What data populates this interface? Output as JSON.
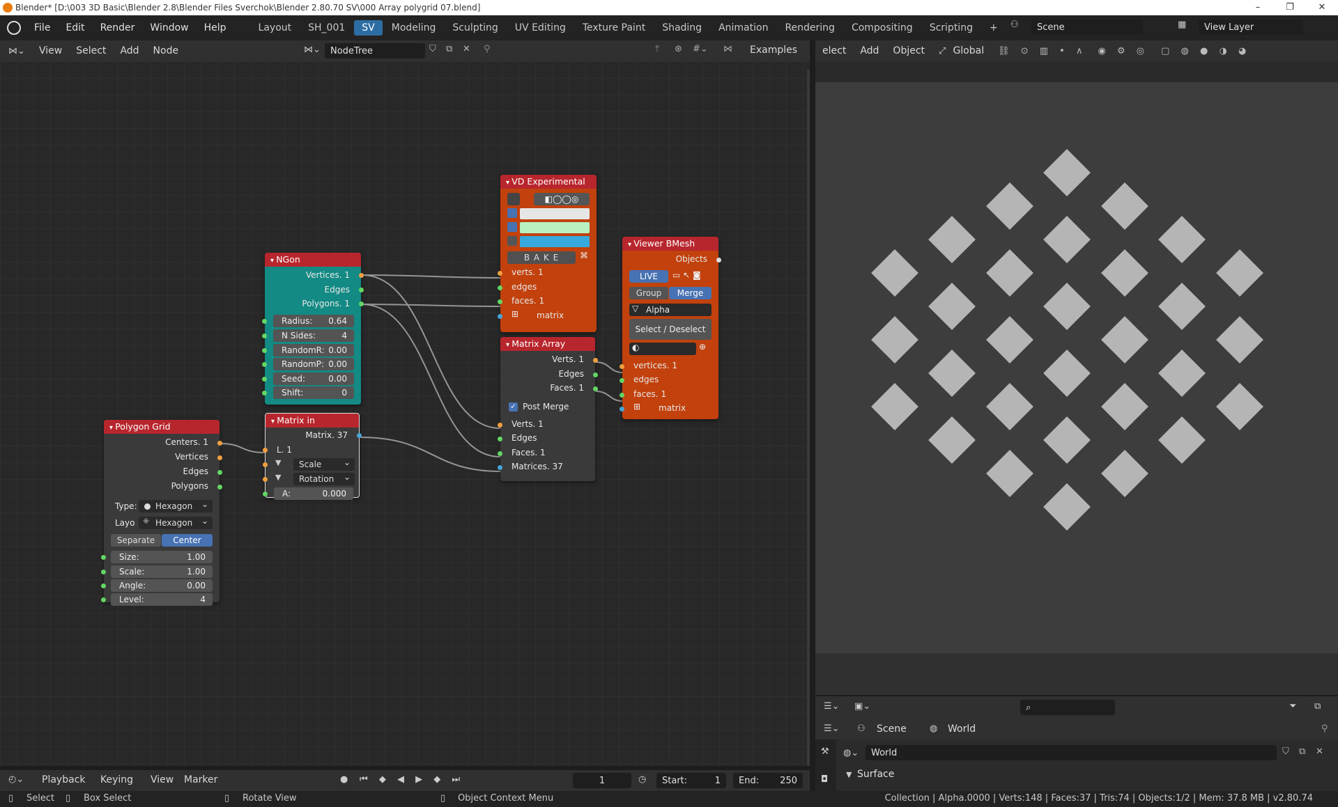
{
  "window": {
    "title": "Blender* [D:\\003 3D Basic\\Blender 2.8\\Blender Files Sverchok\\Blender 2.80.70 SV\\000 Array polygrid 07.blend]"
  },
  "topbar": {
    "menus": [
      "File",
      "Edit",
      "Render",
      "Window",
      "Help"
    ],
    "workspaces": [
      "Layout",
      "SH_001",
      "SV",
      "Modeling",
      "Sculpting",
      "UV Editing",
      "Texture Paint",
      "Shading",
      "Animation",
      "Rendering",
      "Compositing",
      "Scripting"
    ],
    "active_workspace": "SV",
    "add_tab": "+",
    "scene": "Scene",
    "view_layer": "View Layer"
  },
  "node_header": {
    "menus": [
      "View",
      "Select",
      "Add",
      "Node"
    ],
    "tree_name": "NodeTree",
    "examples": "Examples"
  },
  "viewport_header": {
    "menus": [
      "elect",
      "Add",
      "Object"
    ],
    "orientation": "Global"
  },
  "nodes": {
    "ngon": {
      "title": "NGon",
      "outputs": [
        "Vertices. 1",
        "Edges",
        "Polygons. 1"
      ],
      "fields": [
        {
          "label": "Radius:",
          "value": "0.64"
        },
        {
          "label": "N Sides:",
          "value": "4"
        },
        {
          "label": "RandomR:",
          "value": "0.00"
        },
        {
          "label": "RandomP:",
          "value": "0.00"
        },
        {
          "label": "Seed:",
          "value": "0.00"
        },
        {
          "label": "Shift:",
          "value": "0"
        }
      ]
    },
    "polygon_grid": {
      "title": "Polygon Grid",
      "outputs": [
        "Centers. 1",
        "Vertices",
        "Edges",
        "Polygons"
      ],
      "type_label": "Type:",
      "type_value": "Hexagon",
      "layout_label": "Layo",
      "layout_value": "Hexagon",
      "mode_buttons": [
        "Separate",
        "Center"
      ],
      "fields": [
        {
          "label": "Size:",
          "value": "1.00"
        },
        {
          "label": "Scale:",
          "value": "1.00"
        },
        {
          "label": "Angle:",
          "value": "0.00"
        },
        {
          "label": "Level:",
          "value": "4"
        }
      ]
    },
    "matrix_in": {
      "title": "Matrix in",
      "output": "Matrix. 37",
      "input_l": "L. 1",
      "scale": "Scale",
      "rotation": "Rotation",
      "a_label": "A:",
      "a_value": "0.000"
    },
    "vd_experimental": {
      "title": "VD Experimental",
      "bake": "B A K E",
      "inputs": [
        "verts. 1",
        "edges",
        "faces. 1",
        "matrix"
      ]
    },
    "matrix_array": {
      "title": "Matrix Array",
      "outputs": [
        "Verts. 1",
        "Edges",
        "Faces. 1"
      ],
      "post_merge": "Post Merge",
      "inputs": [
        "Verts. 1",
        "Edges",
        "Faces. 1",
        "Matrices. 37"
      ]
    },
    "viewer_bmesh": {
      "title": "Viewer BMesh",
      "output": "Objects",
      "live": "LIVE",
      "group": "Group",
      "merge": "Merge",
      "alpha": "Alpha",
      "select_deselect": "Select / Deselect",
      "inputs": [
        "vertices. 1",
        "edges",
        "faces. 1",
        "matrix"
      ]
    }
  },
  "properties": {
    "scene": "Scene",
    "world": "World",
    "world_field": "World",
    "surface": "Surface"
  },
  "timeline": {
    "menus": [
      "Playback",
      "Keying",
      "View",
      "Marker"
    ],
    "current_frame": "1",
    "start_label": "Start:",
    "start_value": "1",
    "end_label": "End:",
    "end_value": "250"
  },
  "statusbar": {
    "select": "Select",
    "box_select": "Box Select",
    "rotate_view": "Rotate View",
    "context_menu": "Object Context Menu",
    "stats": "Collection | Alpha.0000 | Verts:148 | Faces:37 | Tris:74 | Objects:1/2 | Mem: 37.8 MB | v2.80.74"
  },
  "colors": {
    "accent": "#2e6da3",
    "node_red": "#b8262d",
    "node_teal": "#138a84",
    "node_orange": "#c2410c"
  }
}
